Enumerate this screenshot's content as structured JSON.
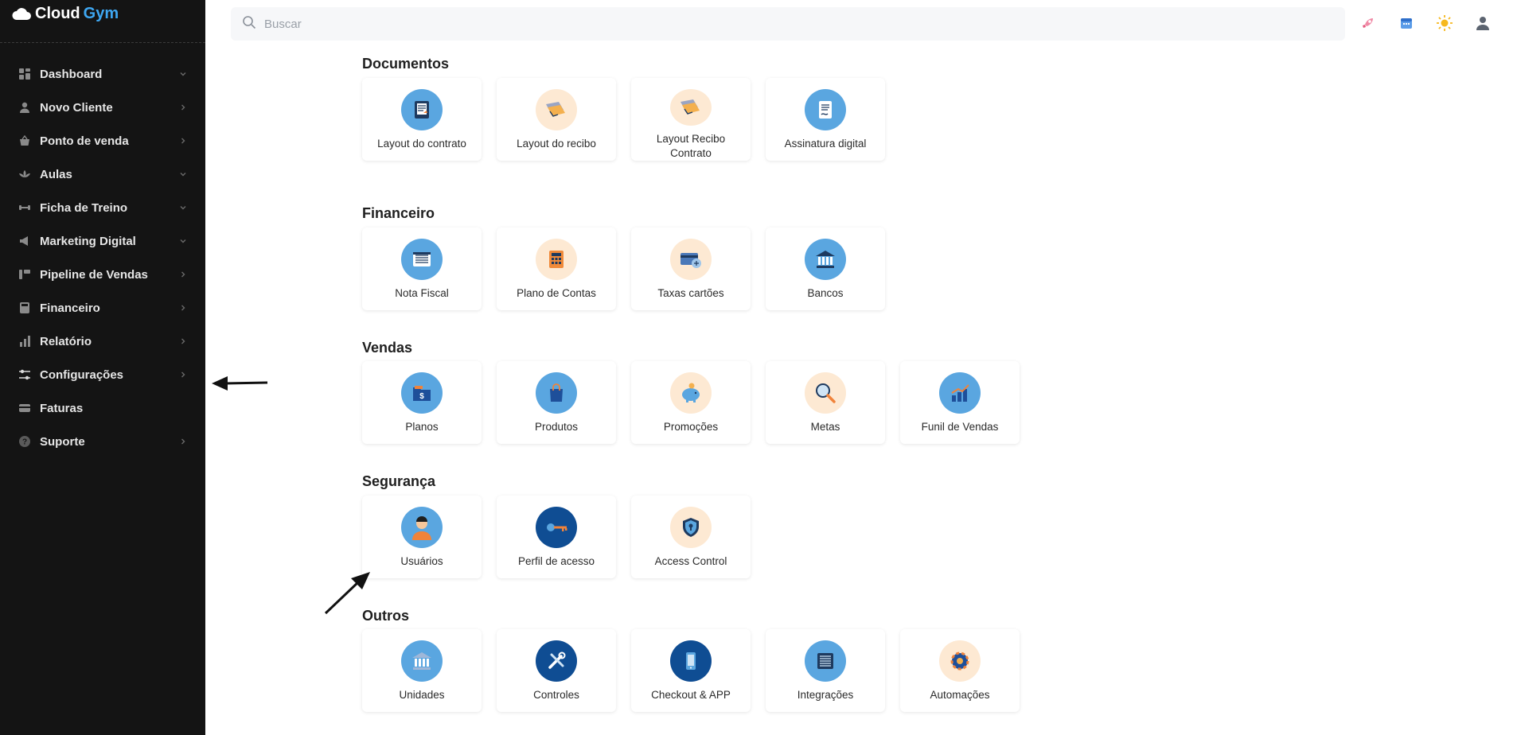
{
  "app": {
    "logo_word1": "Cloud",
    "logo_word2": "Gym"
  },
  "sidebar": {
    "items": [
      {
        "label": "Dashboard",
        "icon": "dashboard-icon",
        "chevron": "down"
      },
      {
        "label": "Novo Cliente",
        "icon": "user-icon",
        "chevron": "right"
      },
      {
        "label": "Ponto de venda",
        "icon": "basket-icon",
        "chevron": "right"
      },
      {
        "label": "Aulas",
        "icon": "lotus-icon",
        "chevron": "down"
      },
      {
        "label": "Ficha de Treino",
        "icon": "dumbbell-icon",
        "chevron": "down"
      },
      {
        "label": "Marketing Digital",
        "icon": "megaphone-icon",
        "chevron": "down"
      },
      {
        "label": "Pipeline de Vendas",
        "icon": "pipeline-icon",
        "chevron": "right"
      },
      {
        "label": "Financeiro",
        "icon": "calculator-icon",
        "chevron": "right"
      },
      {
        "label": "Relatório",
        "icon": "bar-chart-icon",
        "chevron": "right"
      },
      {
        "label": "Configurações",
        "icon": "sliders-icon",
        "chevron": "right"
      },
      {
        "label": "Faturas",
        "icon": "credit-card-icon",
        "chevron": ""
      },
      {
        "label": "Suporte",
        "icon": "help-icon",
        "chevron": "right"
      }
    ]
  },
  "search": {
    "placeholder": "Buscar"
  },
  "topbar": {
    "icons": [
      "rocket-icon",
      "calendar-icon",
      "sun-icon",
      "profile-icon"
    ]
  },
  "sections": [
    {
      "title": "Documentos",
      "items": [
        {
          "label": "Layout do contrato",
          "icon": "contract-icon",
          "bg": "blue"
        },
        {
          "label": "Layout do recibo",
          "icon": "receipt-icon",
          "bg": "peach"
        },
        {
          "label": "Layout Recibo Contrato",
          "icon": "receipt-contract-icon",
          "bg": "peach"
        },
        {
          "label": "Assinatura digital",
          "icon": "signature-icon",
          "bg": "blue"
        }
      ]
    },
    {
      "title": "Financeiro",
      "items": [
        {
          "label": "Nota Fiscal",
          "icon": "invoice-icon",
          "bg": "blue"
        },
        {
          "label": "Plano de Contas",
          "icon": "calculator-icon",
          "bg": "peach"
        },
        {
          "label": "Taxas cartões",
          "icon": "card-fees-icon",
          "bg": "peach"
        },
        {
          "label": "Bancos",
          "icon": "bank-icon",
          "bg": "blue"
        }
      ]
    },
    {
      "title": "Vendas",
      "items": [
        {
          "label": "Planos",
          "icon": "plans-folder-icon",
          "bg": "blue"
        },
        {
          "label": "Produtos",
          "icon": "shopping-bag-icon",
          "bg": "blue"
        },
        {
          "label": "Promoções",
          "icon": "piggy-bank-icon",
          "bg": "peach"
        },
        {
          "label": "Metas",
          "icon": "magnifier-icon",
          "bg": "peach"
        },
        {
          "label": "Funil de Vendas",
          "icon": "growth-chart-icon",
          "bg": "blue"
        }
      ]
    },
    {
      "title": "Segurança",
      "items": [
        {
          "label": "Usuários",
          "icon": "users-person-icon",
          "bg": "blue"
        },
        {
          "label": "Perfil de acesso",
          "icon": "key-icon",
          "bg": "navy"
        },
        {
          "label": "Access Control",
          "icon": "shield-lock-icon",
          "bg": "peach"
        }
      ]
    },
    {
      "title": "Outros",
      "items": [
        {
          "label": "Unidades",
          "icon": "building-icon",
          "bg": "blue"
        },
        {
          "label": "Controles",
          "icon": "tools-icon",
          "bg": "navy"
        },
        {
          "label": "Checkout & APP",
          "icon": "smartphone-icon",
          "bg": "navy"
        },
        {
          "label": "Integrações",
          "icon": "server-icon",
          "bg": "blue"
        },
        {
          "label": "Automações",
          "icon": "gear-automation-icon",
          "bg": "peach"
        }
      ]
    }
  ],
  "colors": {
    "sidebar_bg": "#141414",
    "accent": "#3ea7f2",
    "card_blue": "#5aa6e0",
    "card_navy": "#0f4d93",
    "card_peach": "#fde9d3"
  }
}
